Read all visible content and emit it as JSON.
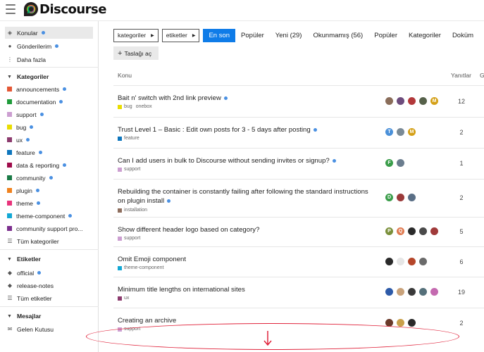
{
  "app": {
    "name": "Discourse"
  },
  "sidebar": {
    "top": [
      {
        "label": "Konular",
        "icon": "layers-icon",
        "dot": true,
        "active": true
      },
      {
        "label": "Gönderilerim",
        "icon": "user-icon",
        "dot": true,
        "active": false
      },
      {
        "label": "Daha fazla",
        "icon": "more-vertical-icon",
        "dot": false,
        "active": false
      }
    ],
    "categories_header": "Kategoriler",
    "categories": [
      {
        "label": "announcements",
        "color": "#e45735",
        "dot": true
      },
      {
        "label": "documentation",
        "color": "#1f9b3a",
        "dot": true
      },
      {
        "label": "support",
        "color": "#cc9fd1",
        "dot": true
      },
      {
        "label": "bug",
        "color": "#e9dd00",
        "dot": true
      },
      {
        "label": "ux",
        "color": "#8c3b6e",
        "dot": true
      },
      {
        "label": "feature",
        "color": "#0e76bd",
        "dot": true
      },
      {
        "label": "data & reporting",
        "color": "#9e0b4a",
        "dot": true
      },
      {
        "label": "community",
        "color": "#1a7a46",
        "dot": true
      },
      {
        "label": "plugin",
        "color": "#f0821e",
        "dot": true
      },
      {
        "label": "theme",
        "color": "#e8337b",
        "dot": true
      },
      {
        "label": "theme-component",
        "color": "#12a8d5",
        "dot": true
      },
      {
        "label": "community support pro...",
        "color": "#7c2f8e",
        "dot": false
      }
    ],
    "all_categories": "Tüm kategoriler",
    "tags_header": "Etiketler",
    "tags": [
      {
        "label": "official",
        "dot": true
      },
      {
        "label": "release-notes",
        "dot": false
      }
    ],
    "all_tags": "Tüm etiketler",
    "messages_header": "Mesajlar",
    "inbox": "Gelen Kutusu"
  },
  "nav": {
    "categories_dropdown": "kategoriler",
    "tags_dropdown": "etiketler",
    "tabs": [
      {
        "label": "En son",
        "active": true
      },
      {
        "label": "Popüler",
        "active": false
      },
      {
        "label": "Yeni (29)",
        "active": false
      },
      {
        "label": "Okunmamış (56)",
        "active": false
      },
      {
        "label": "Popüler",
        "active": false
      },
      {
        "label": "Kategoriler",
        "active": false
      },
      {
        "label": "Doküm",
        "active": false
      }
    ],
    "new_topic": "Taslağı aç"
  },
  "table": {
    "col_topic": "Konu",
    "col_replies": "Yanıtlar",
    "col_more": "G",
    "topics": [
      {
        "title": "Bait n' switch with 2nd link preview",
        "title2": "",
        "dot": true,
        "category": "",
        "cat_color": "#e9dd00",
        "meta": "bug",
        "tags": [
          "onebox"
        ],
        "replies": "12",
        "avatars": [
          {
            "c": "#8a6d5a",
            "l": ""
          },
          {
            "c": "#6d4c7d",
            "l": ""
          },
          {
            "c": "#b2383a",
            "l": ""
          },
          {
            "c": "#56614a",
            "l": ""
          },
          {
            "c": "#d4a017",
            "l": "M"
          }
        ]
      },
      {
        "title": "Trust Level 1 – Basic : Edit own posts for 3 - 5 days after posting",
        "title2": "",
        "dot": true,
        "cat_color": "#0e76bd",
        "meta": "feature",
        "tags": [],
        "replies": "2",
        "avatars": [
          {
            "c": "#4a90d9",
            "l": "T"
          },
          {
            "c": "#7a8a96",
            "l": ""
          },
          {
            "c": "#d4a017",
            "l": "M"
          }
        ]
      },
      {
        "title": "Can I add users in bulk to Discourse without sending invites or signup?",
        "title2": "",
        "dot": true,
        "cat_color": "#cc9fd1",
        "meta": "support",
        "tags": [],
        "replies": "1",
        "avatars": [
          {
            "c": "#3a9d4a",
            "l": "F"
          },
          {
            "c": "#6b7d8e",
            "l": ""
          }
        ]
      },
      {
        "title": "Rebuilding the container is constantly failing after following the standard instructions",
        "title2": "on plugin install",
        "dot": true,
        "cat_color": "#8e6e5e",
        "meta": "installation",
        "tags": [],
        "replies": "2",
        "avatars": [
          {
            "c": "#3a9d4a",
            "l": "D"
          },
          {
            "c": "#9b3a3a",
            "l": ""
          },
          {
            "c": "#5a6f86",
            "l": ""
          }
        ]
      },
      {
        "title": "Show different header logo based on category?",
        "title2": "",
        "dot": false,
        "cat_color": "#cc9fd1",
        "meta": "support",
        "tags": [],
        "replies": "5",
        "avatars": [
          {
            "c": "#7a8f3a",
            "l": "P"
          },
          {
            "c": "#e07a50",
            "l": "Q"
          },
          {
            "c": "#2a2a2a",
            "l": ""
          },
          {
            "c": "#4a4a4a",
            "l": ""
          },
          {
            "c": "#a03a3a",
            "l": ""
          }
        ]
      },
      {
        "title": "Omit Emoji component",
        "title2": "",
        "dot": false,
        "cat_color": "#12a8d5",
        "meta": "theme-component",
        "tags": [],
        "replies": "6",
        "avatars": [
          {
            "c": "#2a2a2a",
            "l": ""
          },
          {
            "c": "#e6e6e6",
            "l": ""
          },
          {
            "c": "#b5462a",
            "l": ""
          },
          {
            "c": "#6a6a6a",
            "l": ""
          }
        ]
      },
      {
        "title": "Minimum title lengths on international sites",
        "title2": "",
        "dot": false,
        "cat_color": "#8c3b6e",
        "meta": "ux",
        "tags": [],
        "replies": "19",
        "avatars": [
          {
            "c": "#2d5aa8",
            "l": ""
          },
          {
            "c": "#c9a27a",
            "l": ""
          },
          {
            "c": "#3a3a3a",
            "l": ""
          },
          {
            "c": "#55707a",
            "l": ""
          },
          {
            "c": "#c46ab0",
            "l": ""
          }
        ]
      },
      {
        "title": "Creating an archive",
        "title2": "",
        "dot": false,
        "cat_color": "#cc9fd1",
        "meta": "support",
        "tags": [],
        "replies": "2",
        "avatars": [
          {
            "c": "#6a3a2a",
            "l": ""
          },
          {
            "c": "#c9a04a",
            "l": ""
          },
          {
            "c": "#2a2a2a",
            "l": ""
          }
        ]
      }
    ]
  },
  "colors": {
    "accent": "#0f7ce8",
    "unread_dot": "#4a90e2",
    "annotation": "#e0223a"
  }
}
